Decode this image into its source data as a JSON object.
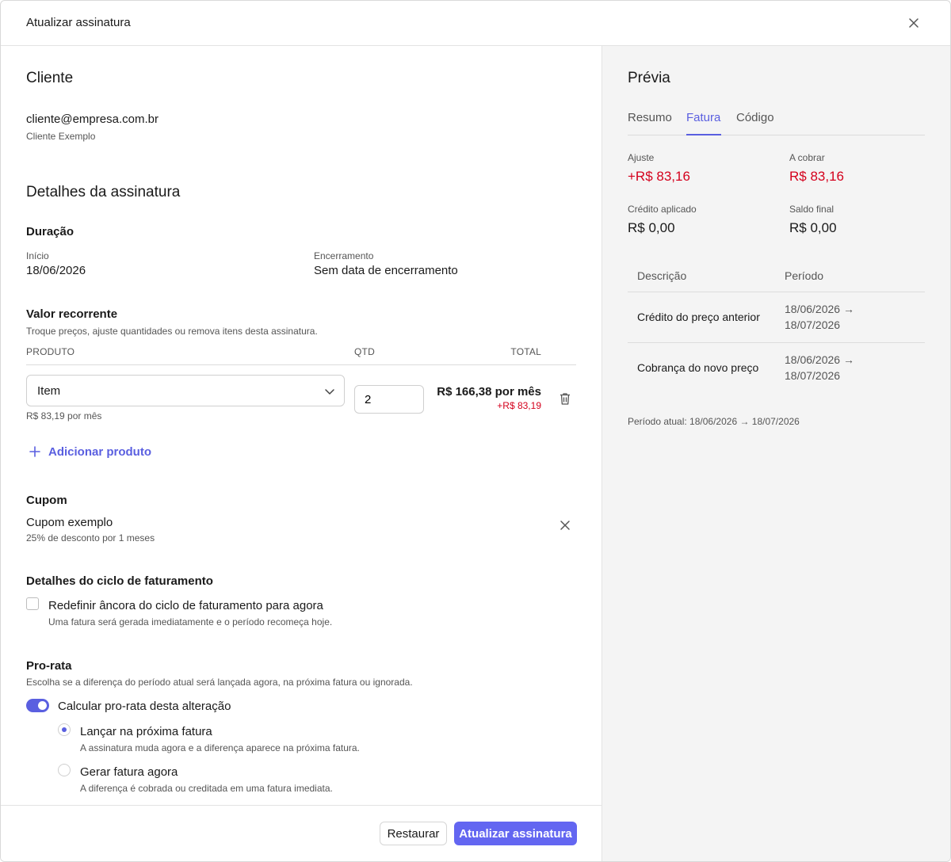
{
  "modal": {
    "title": "Atualizar assinatura"
  },
  "customer": {
    "section_title": "Cliente",
    "email": "cliente@empresa.com.br",
    "name": "Cliente Exemplo"
  },
  "subscription": {
    "section_title": "Detalhes da assinatura",
    "duration": {
      "title": "Duração",
      "start_label": "Início",
      "start_value": "18/06/2026",
      "end_label": "Encerramento",
      "end_value": "Sem data de encerramento"
    },
    "recurring": {
      "title": "Valor recorrente",
      "description": "Troque preços, ajuste quantidades ou remova itens desta assinatura.",
      "col_product": "PRODUTO",
      "col_qty": "QTD",
      "col_total": "TOTAL",
      "item": {
        "product": "Item",
        "unit_price": "R$ 83,19 por mês",
        "qty": "2",
        "total": "R$ 166,38 por mês",
        "diff": "+R$ 83,19"
      },
      "add_label": "Adicionar produto"
    },
    "coupon": {
      "title": "Cupom",
      "name": "Cupom exemplo",
      "description": "25% de desconto por 1 meses"
    },
    "billing_cycle": {
      "title": "Detalhes do ciclo de faturamento",
      "checkbox_label": "Redefinir âncora do ciclo de faturamento para agora",
      "checkbox_help": "Uma fatura será gerada imediatamente e o período recomeça hoje.",
      "checked": false
    },
    "proration": {
      "title": "Pro-rata",
      "description": "Escolha se a diferença do período atual será lançada agora, na próxima fatura ou ignorada.",
      "toggle_label": "Calcular pro-rata desta alteração",
      "toggle_on": true,
      "options": [
        {
          "label": "Lançar na próxima fatura",
          "help": "A assinatura muda agora e a diferença aparece na próxima fatura.",
          "selected": true
        },
        {
          "label": "Gerar fatura agora",
          "help": "A diferença é cobrada ou creditada em uma fatura imediata.",
          "selected": false
        }
      ]
    }
  },
  "footer": {
    "reset_label": "Restaurar",
    "submit_label": "Atualizar assinatura"
  },
  "preview": {
    "title": "Prévia",
    "tabs": [
      {
        "label": "Resumo",
        "active": false
      },
      {
        "label": "Fatura",
        "active": true
      },
      {
        "label": "Código",
        "active": false
      }
    ],
    "adjustment_label": "Ajuste",
    "adjustment_value": "+R$ 83,16",
    "due_label": "A cobrar",
    "due_value": "R$ 83,16",
    "credit_label": "Crédito aplicado",
    "credit_value": "R$ 0,00",
    "balance_label": "Saldo final",
    "balance_value": "R$ 0,00",
    "table": {
      "col_description": "Descrição",
      "col_period": "Período",
      "rows": [
        {
          "description": "Crédito do preço anterior",
          "period_line1": "18/06/2026 →",
          "period_line2": "18/07/2026"
        },
        {
          "description": "Cobrança do novo preço",
          "period_line1": "18/06/2026 →",
          "period_line2": "18/07/2026"
        }
      ]
    },
    "current_period": "Período atual: 18/06/2026 → 18/07/2026"
  },
  "colors": {
    "accent": "#5a5fe0",
    "primary_button": "#6366f1",
    "negative": "#d4001c",
    "panel_bg": "#f4f4f4"
  },
  "icons": [
    "close-icon",
    "chevron-down-icon",
    "trash-icon",
    "plus-icon",
    "close-icon"
  ]
}
